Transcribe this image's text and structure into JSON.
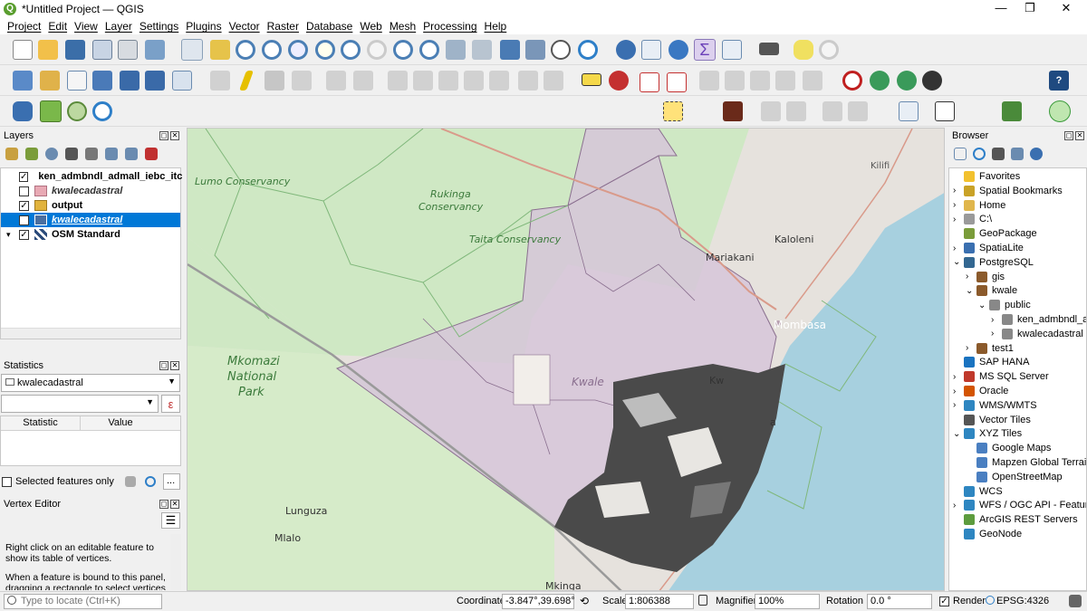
{
  "window": {
    "title": "*Untitled Project — QGIS",
    "minimize": "—",
    "restore": "❐",
    "close": "✕"
  },
  "menu": [
    "Project",
    "Edit",
    "View",
    "Layer",
    "Settings",
    "Plugins",
    "Vector",
    "Raster",
    "Database",
    "Web",
    "Mesh",
    "Processing",
    "Help"
  ],
  "layers_panel": {
    "title": "Layers",
    "items": [
      {
        "name": "ken_admbndl_admall_iebc_itc",
        "checked": true,
        "swatch": "line",
        "color": "#7fbf7f",
        "style": "bold"
      },
      {
        "name": "kwalecadastral",
        "checked": false,
        "swatch": "fill",
        "color": "#e8a9b4",
        "style": "italic"
      },
      {
        "name": "output",
        "checked": true,
        "swatch": "fill",
        "color": "#e1b33c",
        "style": "bold"
      },
      {
        "name": "kwalecadastral",
        "checked": true,
        "swatch": "fill",
        "color": "#4a6fa0",
        "style": "selected"
      },
      {
        "name": "OSM Standard",
        "checked": true,
        "swatch": "raster",
        "color": "#2a4a7a",
        "style": "bold"
      }
    ]
  },
  "statistics_panel": {
    "title": "Statistics",
    "layer": "kwalecadastral",
    "expr_button": "ε",
    "col_statistic": "Statistic",
    "col_value": "Value",
    "selected_only": "Selected features only",
    "more": "..."
  },
  "vertex_panel": {
    "title": "Vertex Editor",
    "text1": "Right click on an editable feature to show its table of vertices.",
    "text2": "When a feature is bound to this panel, dragging a rectangle to select vertices"
  },
  "map": {
    "labels": {
      "lumo": "Lumo Conservancy",
      "rukinga1": "Rukinga",
      "rukinga2": "Conservancy",
      "taita": "Taita Conservancy",
      "mkomazi1": "Mkomazi",
      "mkomazi2": "National",
      "mkomazi3": "Park",
      "kwale": "Kwale",
      "kilifi": "Kilifi",
      "kaloleni": "Kaloleni",
      "mariakani": "Mariakani",
      "mombasa": "Mombasa",
      "lunguza": "Lunguza",
      "mlalo": "Mlalo",
      "mkinga": "Mkinga",
      "kw": "Kw",
      "ra": "a"
    }
  },
  "browser_panel": {
    "title": "Browser",
    "items": [
      {
        "label": "Favorites",
        "depth": 0,
        "exp": "",
        "icon": "#f2c12e"
      },
      {
        "label": "Spatial Bookmarks",
        "depth": 0,
        "exp": "›",
        "icon": "#c9a227"
      },
      {
        "label": "Home",
        "depth": 0,
        "exp": "›",
        "icon": "#e0b64c"
      },
      {
        "label": "C:\\",
        "depth": 0,
        "exp": "›",
        "icon": "#9a9a9a"
      },
      {
        "label": "GeoPackage",
        "depth": 0,
        "exp": "",
        "icon": "#7a9c3a"
      },
      {
        "label": "SpatiaLite",
        "depth": 0,
        "exp": "›",
        "icon": "#3a6fb0"
      },
      {
        "label": "PostgreSQL",
        "depth": 0,
        "exp": "⌄",
        "icon": "#336791"
      },
      {
        "label": "gis",
        "depth": 1,
        "exp": "›",
        "icon": "#8b5a2b"
      },
      {
        "label": "kwale",
        "depth": 1,
        "exp": "⌄",
        "icon": "#8b5a2b"
      },
      {
        "label": "public",
        "depth": 2,
        "exp": "⌄",
        "icon": "#888888"
      },
      {
        "label": "ken_admbndl_a",
        "depth": 3,
        "exp": "›",
        "icon": "#888888"
      },
      {
        "label": "kwalecadastral",
        "depth": 3,
        "exp": "›",
        "icon": "#888888"
      },
      {
        "label": "test1",
        "depth": 1,
        "exp": "›",
        "icon": "#8b5a2b"
      },
      {
        "label": "SAP HANA",
        "depth": 0,
        "exp": "",
        "icon": "#1a73c0"
      },
      {
        "label": "MS SQL Server",
        "depth": 0,
        "exp": "›",
        "icon": "#c0392b"
      },
      {
        "label": "Oracle",
        "depth": 0,
        "exp": "›",
        "icon": "#d35400"
      },
      {
        "label": "WMS/WMTS",
        "depth": 0,
        "exp": "›",
        "icon": "#2e86c1"
      },
      {
        "label": "Vector Tiles",
        "depth": 0,
        "exp": "",
        "icon": "#555555"
      },
      {
        "label": "XYZ Tiles",
        "depth": 0,
        "exp": "⌄",
        "icon": "#2e86c1"
      },
      {
        "label": "Google Maps",
        "depth": 1,
        "exp": "",
        "icon": "#4a7fc1"
      },
      {
        "label": "Mapzen Global Terrain",
        "depth": 1,
        "exp": "",
        "icon": "#4a7fc1"
      },
      {
        "label": "OpenStreetMap",
        "depth": 1,
        "exp": "",
        "icon": "#4a7fc1"
      },
      {
        "label": "WCS",
        "depth": 0,
        "exp": "",
        "icon": "#2e86c1"
      },
      {
        "label": "WFS / OGC API - Features",
        "depth": 0,
        "exp": "›",
        "icon": "#2e86c1"
      },
      {
        "label": "ArcGIS REST Servers",
        "depth": 0,
        "exp": "",
        "icon": "#5d9c3e"
      },
      {
        "label": "GeoNode",
        "depth": 0,
        "exp": "",
        "icon": "#2e86c1"
      }
    ]
  },
  "statusbar": {
    "locator_placeholder": "Type to locate (Ctrl+K)",
    "coordinate_label": "Coordinate",
    "coordinate": "-3.847°,39.698°",
    "scale_label": "Scale",
    "scale": "1:806388",
    "magnifier_label": "Magnifier",
    "magnifier": "100%",
    "rotation_label": "Rotation",
    "rotation": "0.0 °",
    "render_label": "Render",
    "crs": "EPSG:4326"
  }
}
